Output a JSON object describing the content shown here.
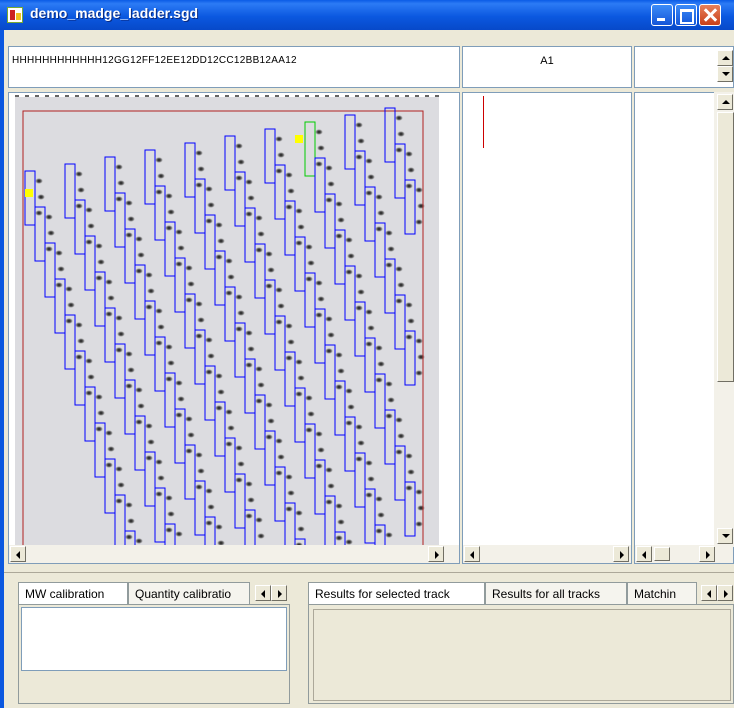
{
  "window": {
    "title": "demo_madge_ladder.sgd",
    "icon": "app-icon"
  },
  "header": {
    "lane_labels": "HHHHHHHHHHHH12GG12FF12EE12DD12CC12BB12AA12",
    "selected_lane": "A1"
  },
  "bottom_left": {
    "tabs": [
      {
        "label": "MW calibration",
        "active": true
      },
      {
        "label": "Quantity calibratio",
        "active": false
      }
    ]
  },
  "bottom_right": {
    "tabs": [
      {
        "label": "Results for selected track",
        "active": true
      },
      {
        "label": "Results for all tracks",
        "active": false
      },
      {
        "label": "Matchin",
        "active": false
      }
    ]
  },
  "colors": {
    "title_bar": "#0A5BE6",
    "lane_box": "#0000FF",
    "selected_lane_box": "#00CC00",
    "marker": "#FFFF00",
    "boundary": "#B02020",
    "trace_line": "#CC0000"
  },
  "icons": [
    "minimize-icon",
    "maximize-icon",
    "close-icon",
    "scroll-up-icon",
    "scroll-down-icon",
    "scroll-left-icon",
    "scroll-right-icon",
    "tab-scroll-left-icon",
    "tab-scroll-right-icon"
  ]
}
